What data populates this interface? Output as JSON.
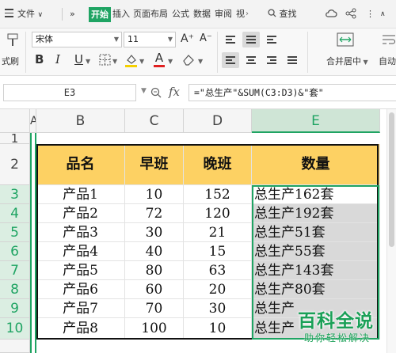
{
  "menubar": {
    "file": "文件",
    "more": "»",
    "tabs": [
      "开始",
      "插入",
      "页面布局",
      "公式",
      "数据",
      "审阅",
      "视"
    ],
    "search": "查找"
  },
  "ribbon": {
    "format_painter": "式刷",
    "font_name": "宋体",
    "font_size": "11",
    "bold": "B",
    "italic": "I",
    "underline": "U",
    "font_color": "A",
    "grow_font": "A⁺",
    "shrink_font": "A⁻",
    "merge_center": "合并居中",
    "auto_wrap": "自动"
  },
  "formula_bar": {
    "cell_ref": "E3",
    "fx": "fx",
    "formula": "=\"总生产\"&SUM(C3:D3)&\"套\""
  },
  "sheet": {
    "columns": [
      "A",
      "B",
      "C",
      "D",
      "E"
    ],
    "selected_column": "E",
    "rows": [
      "1",
      "2",
      "3",
      "4",
      "5",
      "6",
      "7",
      "8",
      "9",
      "10"
    ],
    "headers": [
      "品名",
      "早班",
      "晚班",
      "数量"
    ],
    "data": [
      [
        "产品1",
        "10",
        "152",
        "总生产162套"
      ],
      [
        "产品2",
        "72",
        "120",
        "总生产192套"
      ],
      [
        "产品3",
        "30",
        "21",
        "总生产51套"
      ],
      [
        "产品4",
        "40",
        "15",
        "总生产55套"
      ],
      [
        "产品5",
        "80",
        "63",
        "总生产143套"
      ],
      [
        "产品6",
        "60",
        "20",
        "总生产80套"
      ],
      [
        "产品7",
        "70",
        "30",
        "总生产"
      ],
      [
        "产品8",
        "100",
        "10",
        "总生产"
      ]
    ]
  },
  "watermark": {
    "title": "百科全说",
    "subtitle": "助你轻松解决"
  },
  "colors": {
    "accent": "#1fa463",
    "header_fill": "#fdd163",
    "selection_fill": "#d9d9d9"
  }
}
